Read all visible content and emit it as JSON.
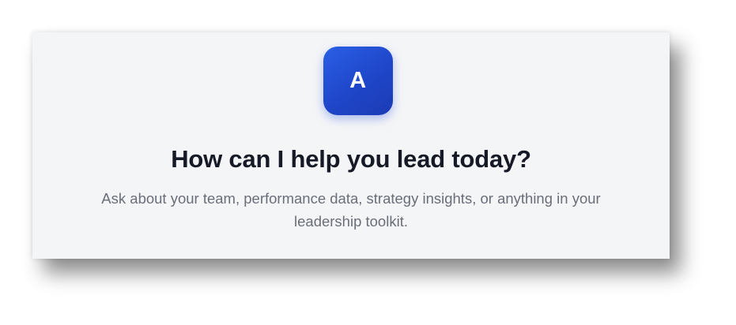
{
  "card": {
    "avatar": {
      "letter": "A",
      "accent_color": "#2352db"
    },
    "title": "How can I help you lead today?",
    "subtitle": "Ask about your team, performance data, strategy insights, or anything in your leadership toolkit."
  }
}
